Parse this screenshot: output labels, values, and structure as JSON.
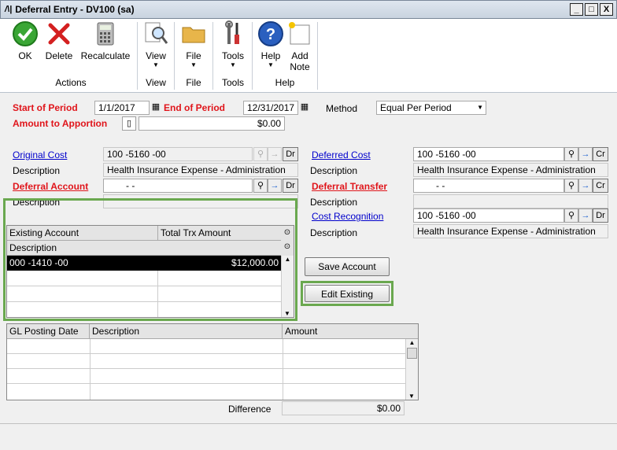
{
  "window": {
    "title": "Deferral Entry  -  DV100 (sa)",
    "min": "_",
    "max": "□",
    "close": "X"
  },
  "ribbon": {
    "ok": "OK",
    "delete": "Delete",
    "recalculate": "Recalculate",
    "view": "View",
    "file": "File",
    "tools": "Tools",
    "help": "Help",
    "add_note_1": "Add",
    "add_note_2": "Note",
    "groups": {
      "actions": "Actions",
      "view": "View",
      "file": "File",
      "tools": "Tools",
      "help": "Help"
    }
  },
  "header": {
    "start_label": "Start of Period",
    "start_value": "1/1/2017",
    "end_label": "End of Period",
    "end_value": "12/31/2017",
    "method_label": "Method",
    "method_value": "Equal Per Period",
    "amount_label": "Amount to Apportion",
    "amount_value": "$0.00"
  },
  "left": {
    "original_cost_label": "Original Cost",
    "original_cost_value": "100 -5160 -00",
    "desc_label": "Description",
    "original_desc": "Health Insurance Expense - Administration",
    "deferral_account_label": "Deferral Account",
    "deferral_account_value": "-        -",
    "desc2_label": "Description",
    "dr": "Dr"
  },
  "right": {
    "deferred_cost_label": "Deferred Cost",
    "deferred_cost_value": "100 -5160 -00",
    "desc_label": "Description",
    "deferred_desc": "Health Insurance Expense - Administration",
    "deferral_transfer_label": "Deferral Transfer",
    "deferral_transfer_value": "-        -",
    "desc2_label": "Description",
    "cost_recognition_label": "Cost Recognition",
    "cost_recognition_value": "100 -5160 -00",
    "desc3_label": "Description",
    "cost_desc": "Health Insurance Expense - Administration",
    "cr": "Cr",
    "dr": "Dr"
  },
  "existing_grid": {
    "col_account": "Existing Account",
    "col_total": "Total Trx Amount",
    "col_desc": "Description",
    "rows": [
      {
        "account": "000 -1410 -00",
        "amount": "$12,000.00"
      }
    ]
  },
  "buttons": {
    "save_account": "Save Account",
    "edit_existing": "Edit Existing"
  },
  "posting_grid": {
    "col_date": "GL Posting Date",
    "col_desc": "Description",
    "col_amount": "Amount"
  },
  "footer": {
    "difference_label": "Difference",
    "difference_value": "$0.00"
  },
  "colors": {
    "accent_red": "#e0151b",
    "highlight_green": "#6aa84f",
    "selected_row": "#000000"
  }
}
